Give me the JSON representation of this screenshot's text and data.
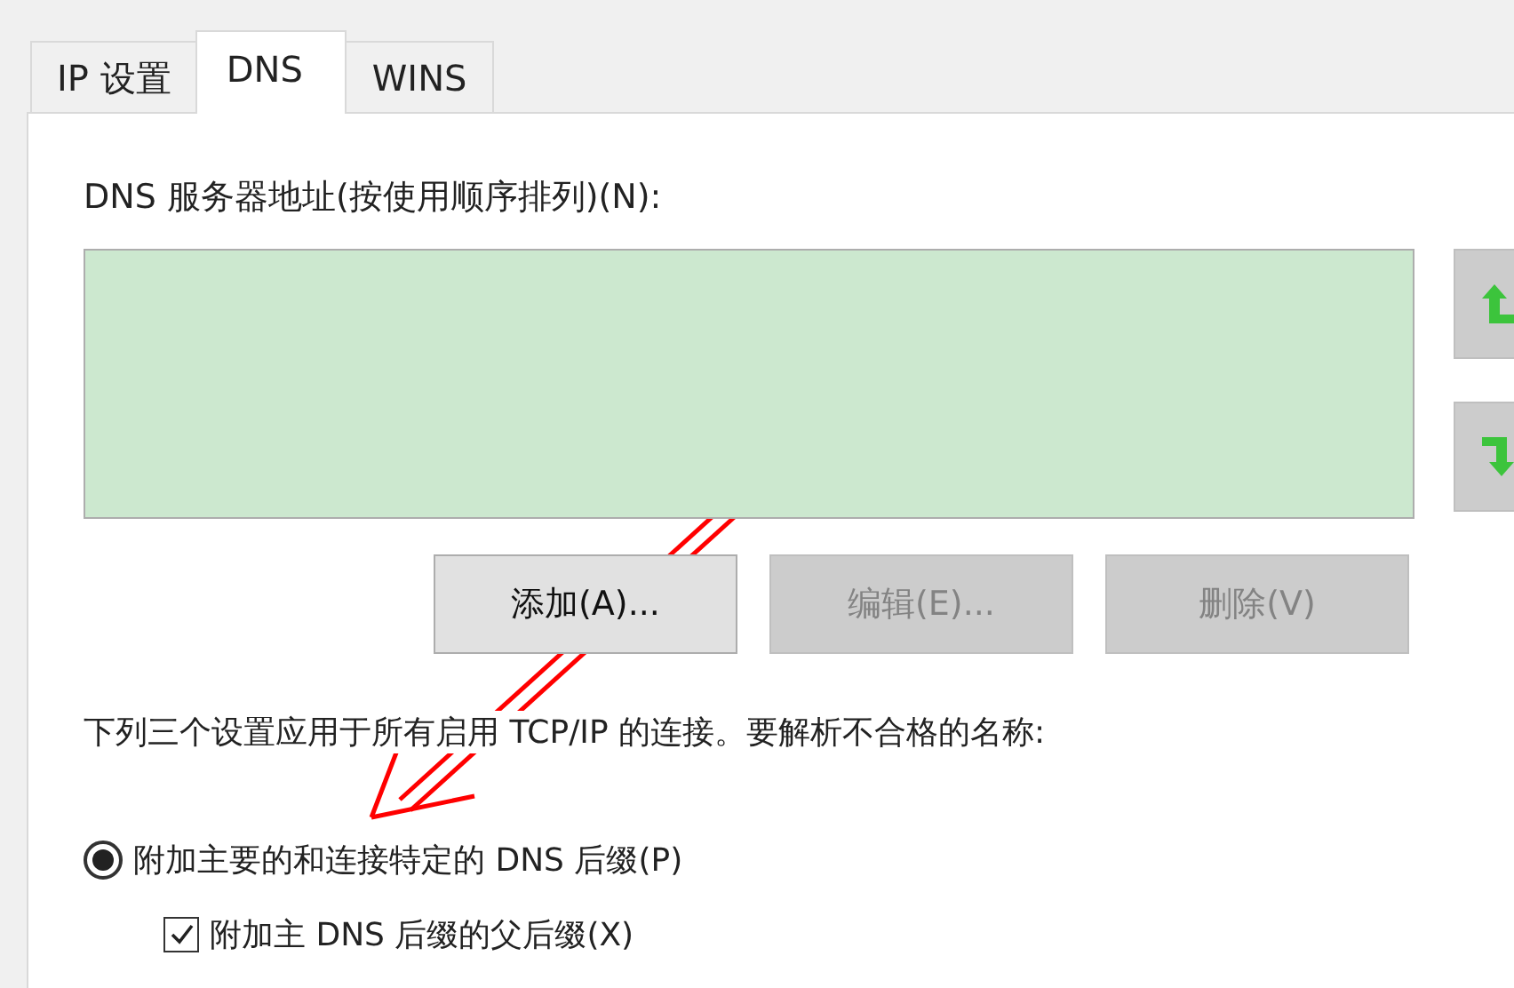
{
  "tabs": [
    {
      "label": "IP 设置",
      "selected": false
    },
    {
      "label": "DNS",
      "selected": true
    },
    {
      "label": "WINS",
      "selected": false
    }
  ],
  "dns_servers": {
    "label": "DNS 服务器地址(按使用顺序排列)(N):"
  },
  "order_buttons": [
    {
      "kind": "up",
      "disabled": true
    },
    {
      "kind": "down",
      "disabled": true
    }
  ],
  "buttons": [
    {
      "label": "添加(A)...",
      "disabled": false
    },
    {
      "label": "编辑(E)...",
      "disabled": true
    },
    {
      "label": "删除(V)",
      "disabled": true
    }
  ],
  "description": "下列三个设置应用于所有启用 TCP/IP 的连接。要解析不合格的名称:",
  "options": [
    {
      "kind": "radio",
      "label": "附加主要的和连接特定的 DNS 后缀(P)",
      "checked": true
    },
    {
      "kind": "checkbox",
      "label": "附加主 DNS 后缀的父后缀(X)",
      "checked": true
    }
  ]
}
